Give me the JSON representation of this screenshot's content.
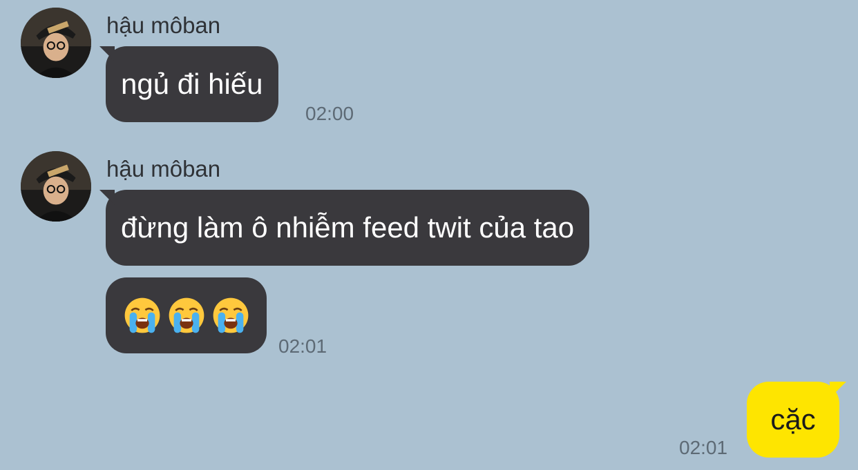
{
  "chat": {
    "messages": [
      {
        "sender": "hậu môban",
        "text": "ngủ đi hiếu",
        "time": "02:00"
      },
      {
        "sender": "hậu môban",
        "text": "đừng làm ô nhiễm feed twit của tao"
      },
      {
        "emoji": "loudly-crying-face",
        "count": 3,
        "time": "02:01"
      }
    ],
    "my_message": {
      "text": "cặc",
      "time": "02:01"
    }
  },
  "colors": {
    "background": "#abc1d1",
    "incoming_bubble": "#3a393d",
    "outgoing_bubble": "#fee500"
  }
}
